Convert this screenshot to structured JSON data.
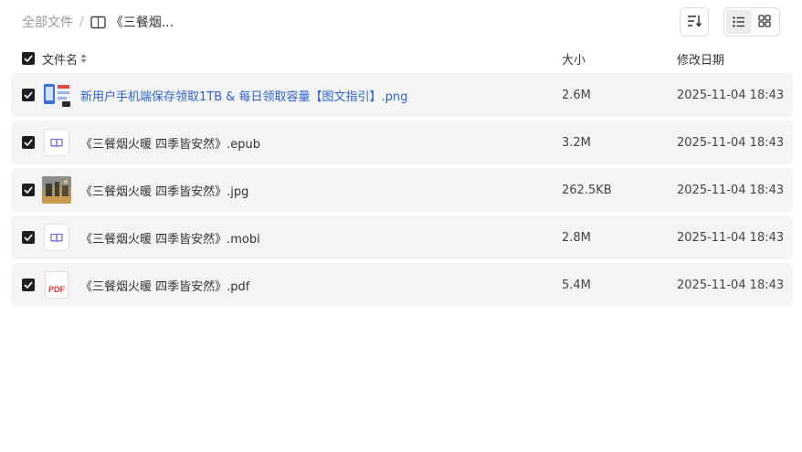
{
  "breadcrumb": {
    "root": "全部文件",
    "separator": "/",
    "current": "《三餐烟..."
  },
  "header": {
    "name": "文件名",
    "size": "大小",
    "date": "修改日期"
  },
  "files": [
    {
      "name": "新用户手机端保存领取1TB & 每日领取容量【图文指引】.png",
      "size": "2.6M",
      "date": "2025-11-04 18:43",
      "type": "png-thumb",
      "checked": true
    },
    {
      "name": "《三餐烟火暖 四季皆安然》.epub",
      "size": "3.2M",
      "date": "2025-11-04 18:43",
      "type": "book-icon",
      "checked": true
    },
    {
      "name": "《三餐烟火暖 四季皆安然》.jpg",
      "size": "262.5KB",
      "date": "2025-11-04 18:43",
      "type": "jpg-thumb",
      "checked": true
    },
    {
      "name": "《三餐烟火暖 四季皆安然》.mobi",
      "size": "2.8M",
      "date": "2025-11-04 18:43",
      "type": "book-icon",
      "checked": true
    },
    {
      "name": "《三餐烟火暖 四季皆安然》.pdf",
      "size": "5.4M",
      "date": "2025-11-04 18:43",
      "type": "pdf-icon",
      "pdf_label": "PDF",
      "checked": true
    }
  ],
  "colors": {
    "row_bg": "#f4f4f5",
    "link": "#2b62d4",
    "book_icon": "#7a6de0",
    "pdf": "#e43c3c"
  }
}
